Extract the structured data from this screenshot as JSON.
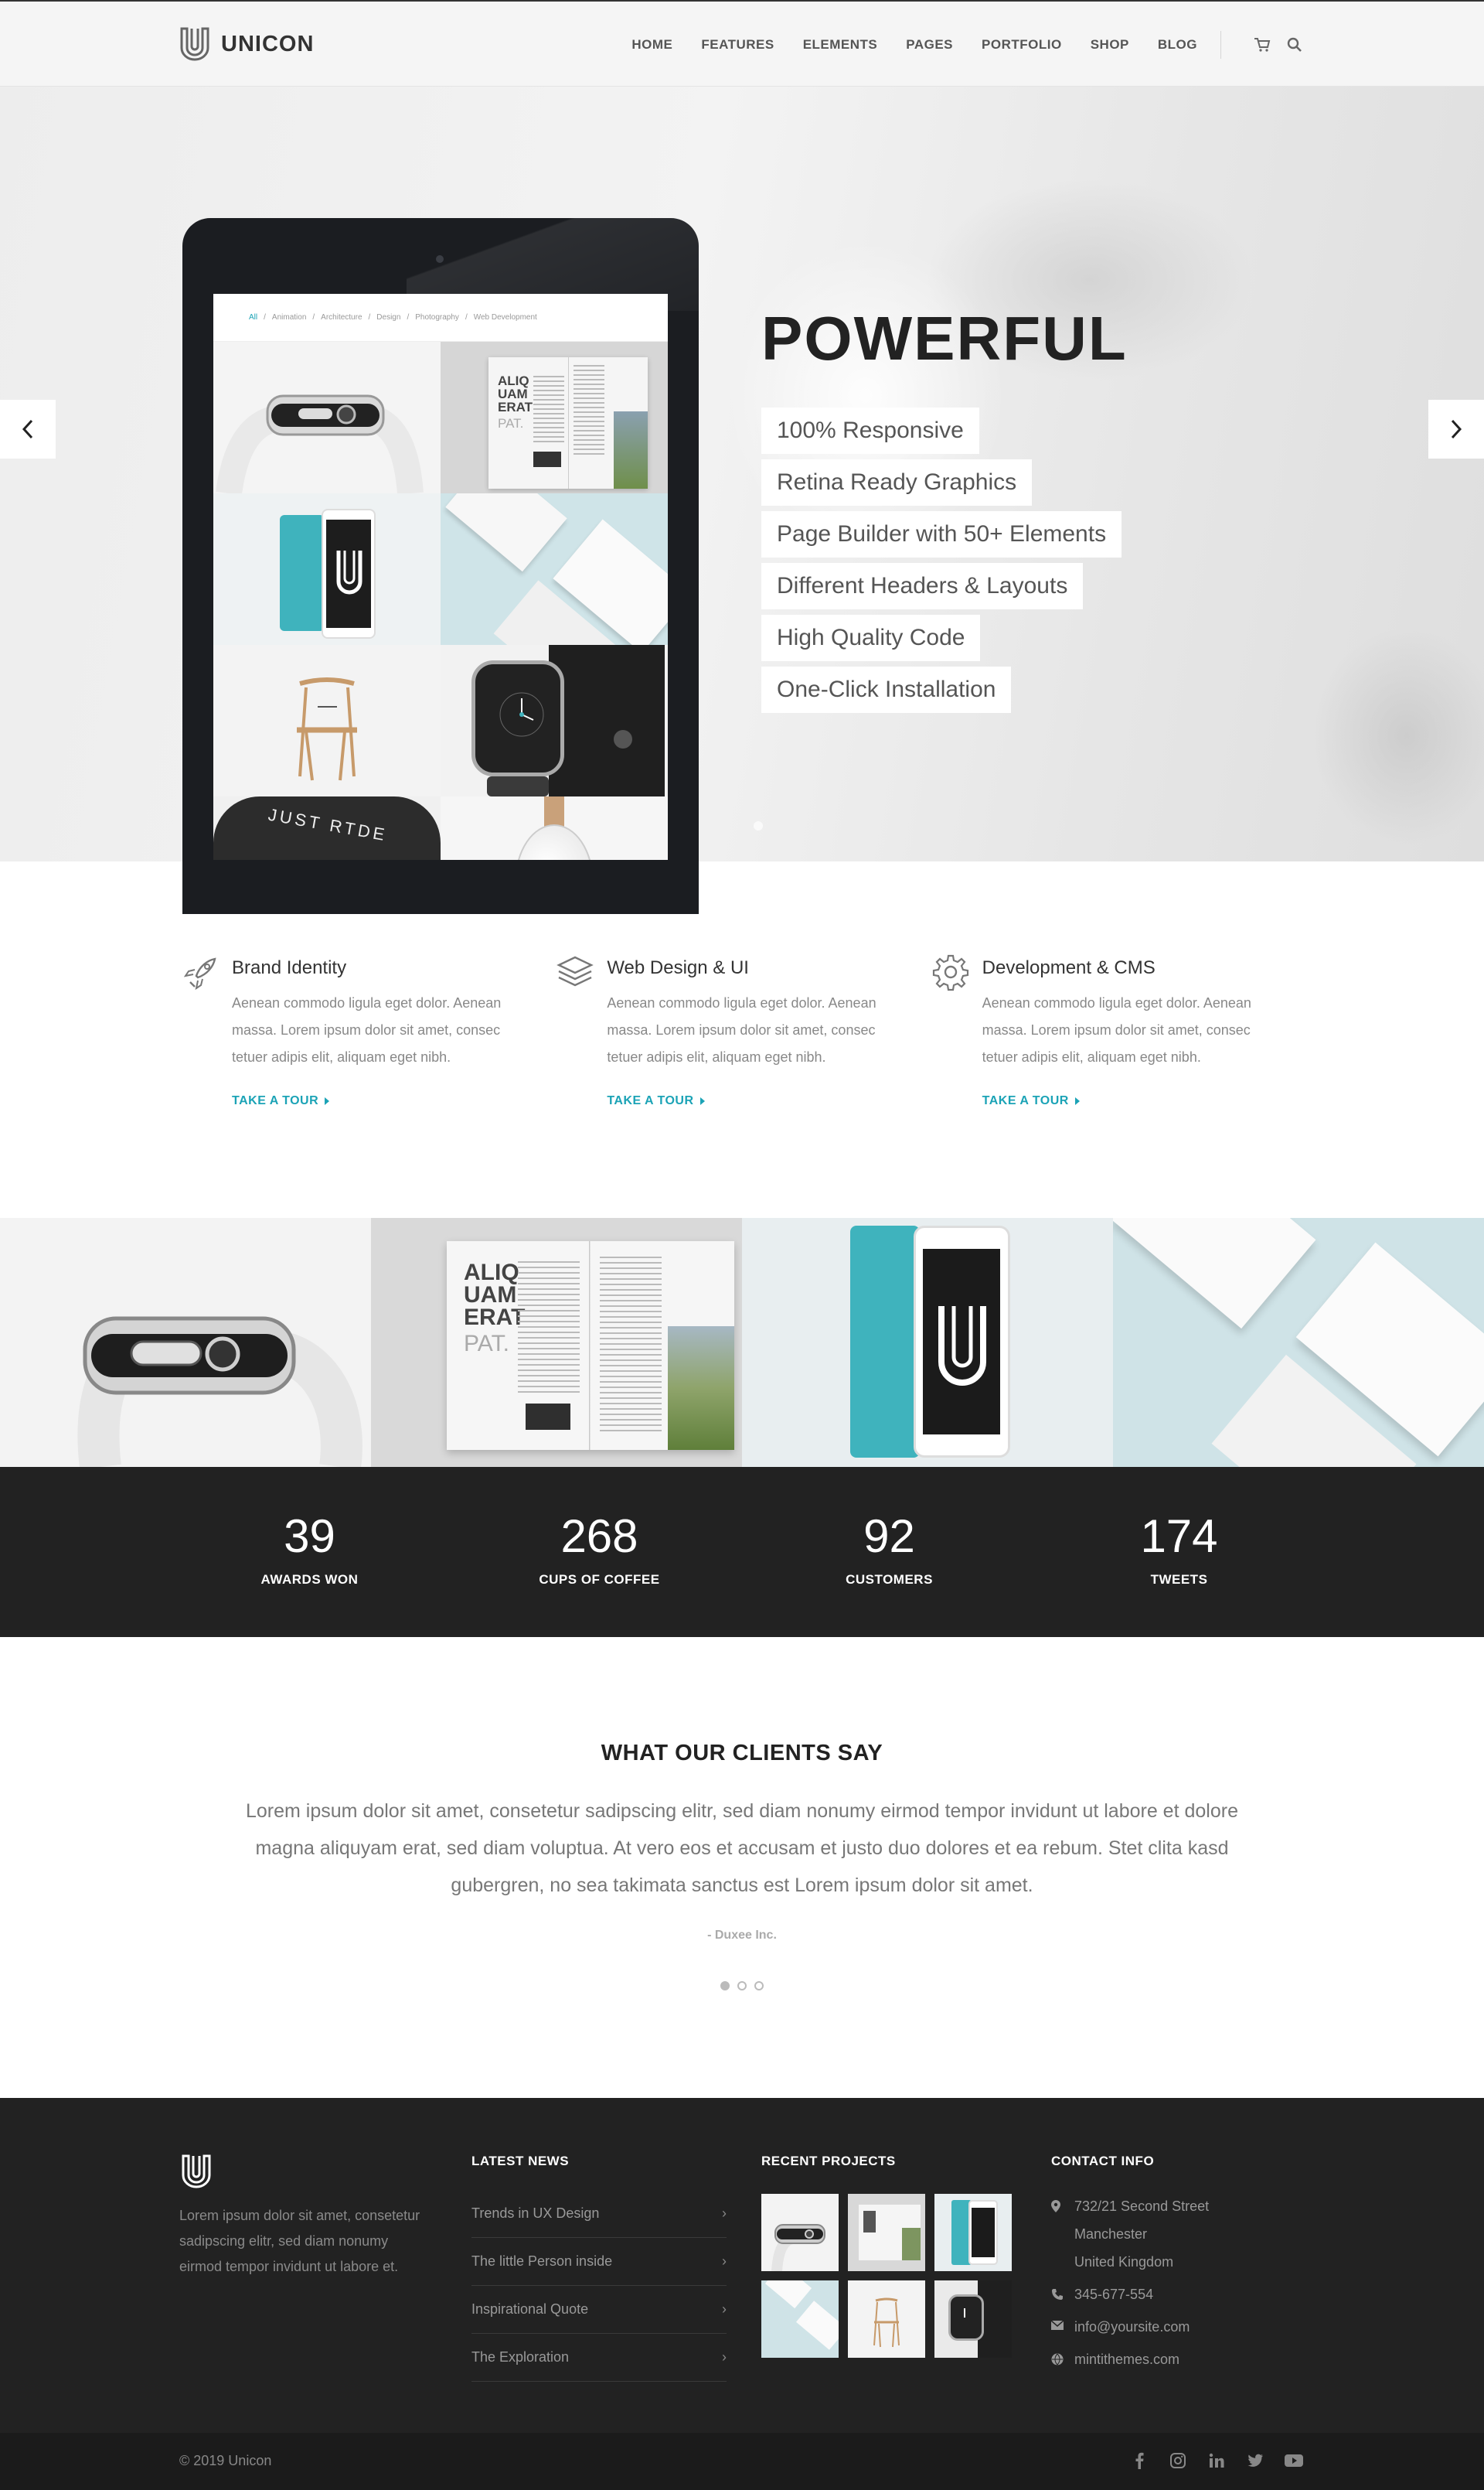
{
  "header": {
    "brand": "UNICON",
    "nav": [
      "HOME",
      "FEATURES",
      "ELEMENTS",
      "PAGES",
      "PORTFOLIO",
      "SHOP",
      "BLOG"
    ]
  },
  "hero": {
    "title": "POWERFUL",
    "bullets": [
      "100% Responsive",
      "Retina Ready Graphics",
      "Page Builder with 50+ Elements",
      "Different Headers & Layouts",
      "High Quality Code",
      "One-Click Installation"
    ],
    "tablet_crumbs": [
      "All",
      "Animation",
      "Architecture",
      "Design",
      "Photography",
      "Web Development"
    ],
    "tablet_book_text": "ALIQ UAM ERAT",
    "tablet_book_light": "PAT.",
    "tablet_hoodie_text": "JUST RTDE"
  },
  "features": [
    {
      "title": "Brand Identity",
      "text": "Aenean commodo ligula eget dolor. Aenean massa. Lorem ipsum dolor sit amet, consec tetuer adipis elit, aliquam eget nibh.",
      "link": "TAKE A TOUR",
      "icon": "rocket-icon"
    },
    {
      "title": "Web Design & UI",
      "text": "Aenean commodo ligula eget dolor. Aenean massa. Lorem ipsum dolor sit amet, consec tetuer adipis elit, aliquam eget nibh.",
      "link": "TAKE A TOUR",
      "icon": "layers-icon"
    },
    {
      "title": "Development & CMS",
      "text": "Aenean commodo ligula eget dolor. Aenean massa. Lorem ipsum dolor sit amet, consec tetuer adipis elit, aliquam eget nibh.",
      "link": "TAKE A TOUR",
      "icon": "gear-icon"
    }
  ],
  "gallery": {
    "book_text": "ALIQ UAM ERAT",
    "book_light": "PAT."
  },
  "counters": [
    {
      "num": "39",
      "label": "AWARDS WON"
    },
    {
      "num": "268",
      "label": "CUPS OF COFFEE"
    },
    {
      "num": "92",
      "label": "CUSTOMERS"
    },
    {
      "num": "174",
      "label": "TWEETS"
    }
  ],
  "testimonial": {
    "title": "WHAT OUR CLIENTS SAY",
    "quote": "Lorem ipsum dolor sit amet, consetetur sadipscing elitr, sed diam nonumy eirmod tempor invidunt ut labore et dolore magna aliquyam erat, sed diam voluptua. At vero eos et accusam et justo duo dolores et ea rebum. Stet clita kasd gubergren, no sea takimata sanctus est Lorem ipsum dolor sit amet.",
    "author": "- Duxee Inc."
  },
  "footer": {
    "about": "Lorem ipsum dolor sit amet, consetetur sadipscing elitr, sed diam nonumy eirmod tempor invidunt ut labore et.",
    "news_heading": "LATEST NEWS",
    "news": [
      "Trends in UX Design",
      "The little Person inside",
      "Inspirational Quote",
      "The Exploration"
    ],
    "projects_heading": "RECENT PROJECTS",
    "contact_heading": "CONTACT INFO",
    "address_line1": "732/21 Second Street",
    "address_line2": "Manchester",
    "address_line3": "United Kingdom",
    "phone": "345-677-554",
    "email": "info@yoursite.com",
    "website": "mintithemes.com",
    "copyright": "© 2019 Unicon"
  },
  "colors": {
    "accent": "#1ba3b6",
    "dark": "#222222",
    "teal_cover": "#3fb3bd"
  }
}
